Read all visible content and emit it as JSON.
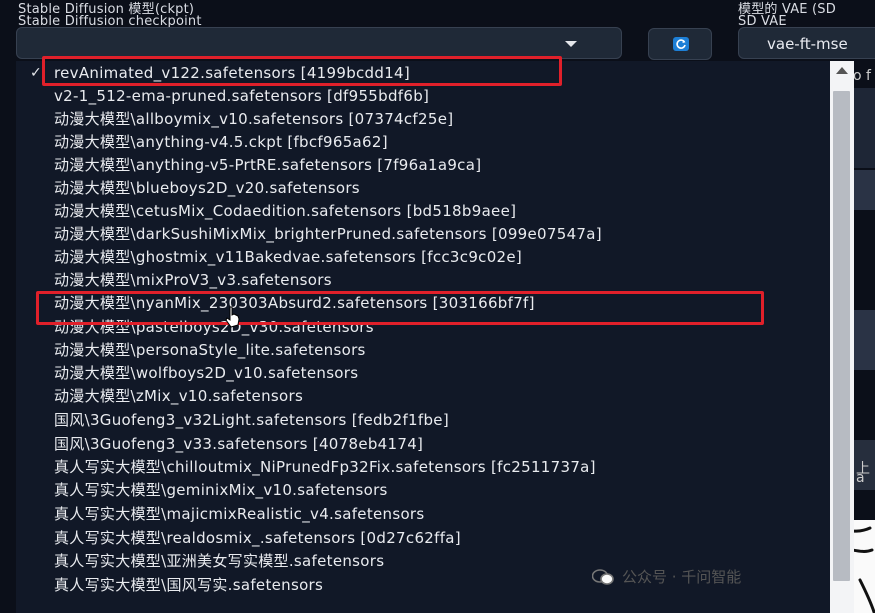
{
  "header": {
    "checkpoint_label_line1": "Stable Diffusion 模型(ckpt)",
    "checkpoint_label_line2": "Stable Diffusion checkpoint",
    "vae_label_line1": "模型的 VAE (SD",
    "vae_label_line2": "SD VAE",
    "vae_value": "vae-ft-mse"
  },
  "icons": {
    "dropdown_caret": "chevron-down-icon",
    "refresh": "refresh-icon",
    "selected_mark": "check-icon",
    "watermark_logo": "wechat-icon",
    "pointer": "hand-cursor-icon"
  },
  "menu": {
    "items": [
      {
        "label": "revAnimated_v122.safetensors [4199bcdd14]",
        "selected": true
      },
      {
        "label": "v2-1_512-ema-pruned.safetensors [df955bdf6b]"
      },
      {
        "label": "动漫大模型\\allboymix_v10.safetensors [07374cf25e]"
      },
      {
        "label": "动漫大模型\\anything-v4.5.ckpt [fbcf965a62]"
      },
      {
        "label": "动漫大模型\\anything-v5-PrtRE.safetensors [7f96a1a9ca]"
      },
      {
        "label": "动漫大模型\\blueboys2D_v20.safetensors"
      },
      {
        "label": "动漫大模型\\cetusMix_Codaedition.safetensors [bd518b9aee]"
      },
      {
        "label": "动漫大模型\\darkSushiMixMix_brighterPruned.safetensors [099e07547a]"
      },
      {
        "label": "动漫大模型\\ghostmix_v11Bakedvae.safetensors [fcc3c9c02e]"
      },
      {
        "label": "动漫大模型\\mixProV3_v3.safetensors"
      },
      {
        "label": "动漫大模型\\nyanMix_230303Absurd2.safetensors [303166bf7f]"
      },
      {
        "label": "动漫大模型\\pastelboys2D_v30.safetensors"
      },
      {
        "label": "动漫大模型\\personaStyle_lite.safetensors"
      },
      {
        "label": "动漫大模型\\wolfboys2D_v10.safetensors"
      },
      {
        "label": "动漫大模型\\zMix_v10.safetensors"
      },
      {
        "label": "国风\\3Guofeng3_v32Light.safetensors [fedb2f1fbe]"
      },
      {
        "label": "国风\\3Guofeng3_v33.safetensors [4078eb4174]"
      },
      {
        "label": "真人写实大模型\\chilloutmix_NiPrunedFp32Fix.safetensors [fc2511737a]"
      },
      {
        "label": "真人写实大模型\\geminixMix_v10.safetensors"
      },
      {
        "label": "真人写实大模型\\majicmixRealistic_v4.safetensors"
      },
      {
        "label": "真人写实大模型\\realdosmix_.safetensors [0d27c62ffa]"
      },
      {
        "label": "真人写实大模型\\亚洲美女写实模型.safetensors"
      },
      {
        "label": "真人写实大模型\\国风写实.safetensors"
      }
    ]
  },
  "background_fragments": [
    "o f",
    "上",
    "a"
  ],
  "watermark": {
    "text": "公众号 · 千问智能"
  },
  "colors": {
    "background": "#0b0f19",
    "menu_bg": "#111827",
    "highlight_box": "#e0202a",
    "refresh_accent": "#1d7fd6"
  }
}
